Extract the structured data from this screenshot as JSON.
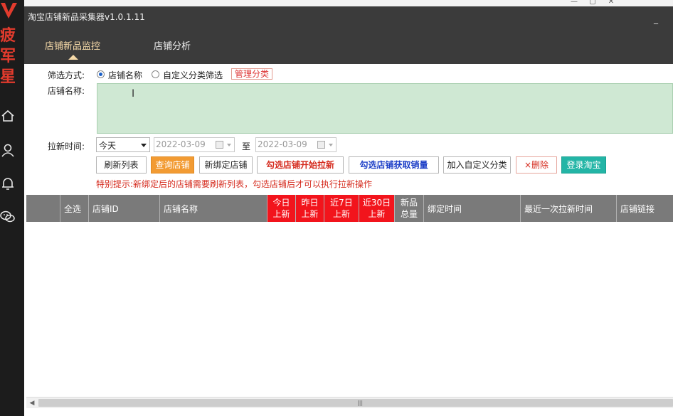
{
  "sidebar": {
    "brand_chars": [
      "疲",
      "军",
      "星"
    ],
    "icons": [
      "home-icon",
      "user-icon",
      "bell-icon",
      "wechat-icon"
    ],
    "accent_color": "#e23b2d"
  },
  "window": {
    "title": "淘宝店铺新品采集器v1.0.1.11",
    "minimize_symbol": "_"
  },
  "tabs": [
    {
      "label": "店铺新品监控",
      "active": true
    },
    {
      "label": "店铺分析",
      "active": false
    }
  ],
  "filter": {
    "mode_label": "筛选方式:",
    "options": [
      {
        "label": "店铺名称",
        "checked": true
      },
      {
        "label": "自定义分类筛选",
        "checked": false
      }
    ],
    "manage_label": "管理分类",
    "shop_name_label": "店铺名称:",
    "shop_name_value": ""
  },
  "date_filter": {
    "label": "拉新时间:",
    "selected": "今天",
    "from": "2022-03-09",
    "to_label": "至",
    "to": "2022-03-09"
  },
  "buttons": {
    "refresh": "刷新列表",
    "query": "查询店铺",
    "bind": "新绑定店铺",
    "start_pull": "勾选店铺开始拉新",
    "get_sales": "勾选店铺获取销量",
    "add_category": "加入自定义分类",
    "delete": "×删除",
    "login": "登录淘宝"
  },
  "notice": "特别提示:新绑定后的店铺需要刷新列表，勾选店铺后才可以执行拉新操作",
  "table": {
    "columns": [
      {
        "key": "select_all",
        "label": "全选"
      },
      {
        "key": "shop_id",
        "label": "店铺ID"
      },
      {
        "key": "shop_name",
        "label": "店铺名称"
      },
      {
        "key": "today",
        "label": "今日上新"
      },
      {
        "key": "yesterday",
        "label": "昨日上新"
      },
      {
        "key": "last7",
        "label": "近7日上新"
      },
      {
        "key": "last30",
        "label": "近30日上新"
      },
      {
        "key": "total",
        "label": "新品总量"
      },
      {
        "key": "bind_time",
        "label": "绑定时间"
      },
      {
        "key": "last_pull",
        "label": "最近一次拉新时间"
      },
      {
        "key": "link",
        "label": "店铺链接"
      }
    ],
    "rows": []
  }
}
